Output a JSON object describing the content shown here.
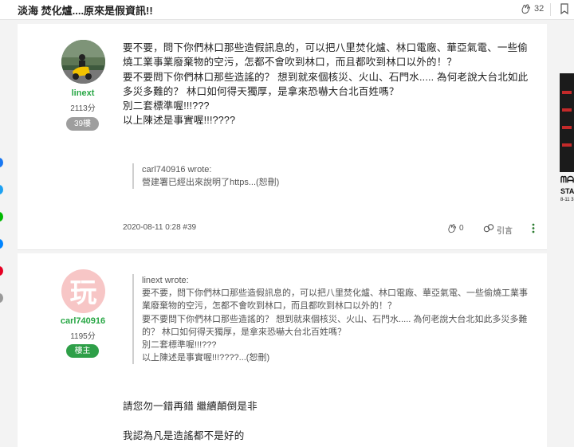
{
  "header": {
    "title": "淡海 焚化爐....原來是假資訊!!",
    "like_count": "32"
  },
  "posts": [
    {
      "author": "linext",
      "score": "2113分",
      "floor_badge": "39樓",
      "content_lines": [
        "要不要，問下你們林口那些造假訊息的，可以把八里焚化爐、林口電廠、華亞氣電、一些偷",
        "燒工業事業廢棄物的空污，怎都不會吹到林口，而且都吹到林口以外的！？",
        "要不要問下你們林口那些造謠的？ 想到就來個核災、火山、石門水..... 為何老說大台北如此",
        "多災多難的？ 林口如何得天獨厚，是拿來恐嚇大台北百姓嗎？",
        "別二套標準喔!!!???",
        "以上陳述是事實喔!!!????"
      ],
      "quote": {
        "author_line": "carl740916 wrote:",
        "lines": [
          "營建署已經出來說明了https...(恕刪)"
        ]
      },
      "date": "2020-08-11 0:28 #39",
      "like_count": "0",
      "quote_label": "引言"
    },
    {
      "author": "carl740916",
      "score": "1195分",
      "role_badge": "樓主",
      "quote": {
        "author_line": "linext wrote:",
        "lines": [
          "要不要，問下你們林口那些造假訊息的，可以把八里焚化爐、林口電廠、華亞氣電、一些偷燒工業事",
          "業廢棄物的空污，怎都不會吹到林口，而且都吹到林口以外的！？",
          "要不要問下你們林口那些造謠的？ 想到就來個核災、火山、石門水..... 為何老說大台北如此多災多難",
          "的？ 林口如何得天獨厚，是拿來恐嚇大台北百姓嗎？",
          "別二套標準喔!!!???",
          "以上陳述是事實喔!!!????...(恕刪)"
        ]
      },
      "content_lines": [
        "請您勿一錯再錯 繼續顛倒是非",
        "",
        "我認為凡是造謠都不是好的"
      ]
    }
  ],
  "sidebar_ad": {
    "line1": "ᗰᗩ",
    "line2": "STA",
    "line3": "8-11 3"
  },
  "colors": {
    "username_green": "#28a745",
    "floor_badge": "#9e9e9e",
    "owner_badge": "#2e9f48"
  }
}
